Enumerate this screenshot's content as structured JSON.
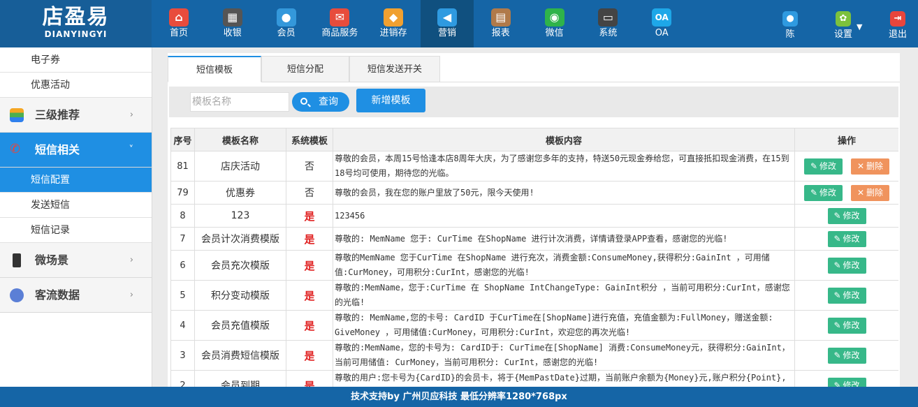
{
  "logo": {
    "cn": "店盈易",
    "en": "DIANYINGYI"
  },
  "nav": [
    {
      "label": "首页",
      "icon": "home-icon",
      "color": "#e84c3d",
      "glyph": "⌂"
    },
    {
      "label": "收银",
      "icon": "cash-register-icon",
      "color": "#555555",
      "glyph": "▦"
    },
    {
      "label": "会员",
      "icon": "member-icon",
      "color": "#3498db",
      "glyph": "●"
    },
    {
      "label": "商品服务",
      "icon": "goods-service-icon",
      "color": "#e74c3c",
      "glyph": "✉"
    },
    {
      "label": "进销存",
      "icon": "inventory-icon",
      "color": "#f0a030",
      "glyph": "◆"
    },
    {
      "label": "营销",
      "icon": "megaphone-icon",
      "color": "#2f9ae0",
      "glyph": "◀"
    },
    {
      "label": "报表",
      "icon": "report-icon",
      "color": "#b07a4a",
      "glyph": "▤"
    },
    {
      "label": "微信",
      "icon": "wechat-icon",
      "color": "#2fb34a",
      "glyph": "◉"
    },
    {
      "label": "系统",
      "icon": "monitor-icon",
      "color": "#444444",
      "glyph": "▭"
    },
    {
      "label": "OA",
      "icon": "oa-icon",
      "color": "#1ea7e8",
      "glyph": "OA"
    }
  ],
  "nav_right": [
    {
      "label": "陈",
      "icon": "user-icon",
      "color": "#2f9ae0",
      "glyph": "●"
    },
    {
      "label": "设置",
      "icon": "settings-icon",
      "color": "#7cc13d",
      "glyph": "✿",
      "caret": "▼"
    },
    {
      "label": "退出",
      "icon": "logout-icon",
      "color": "#e8453c",
      "glyph": "⇥"
    }
  ],
  "sidebar": {
    "top_items": [
      {
        "label": "电子券"
      },
      {
        "label": "优惠活动"
      }
    ],
    "cat_tiered": {
      "label": "三级推荐",
      "icon_color": "#4caf50",
      "arrow": "›"
    },
    "cat_sms": {
      "label": "短信相关",
      "icon_color": "#e8453c",
      "arrow": "˅"
    },
    "sms_items": [
      {
        "label": "短信配置"
      },
      {
        "label": "发送短信"
      },
      {
        "label": "短信记录"
      }
    ],
    "cat_micro": {
      "label": "微场景",
      "icon_color": "#333333",
      "arrow": "›"
    },
    "cat_traffic": {
      "label": "客流数据",
      "icon_color": "#5b7fd6",
      "arrow": "›"
    }
  },
  "tabs": [
    "短信模板",
    "短信分配",
    "短信发送开关"
  ],
  "search": {
    "placeholder": "模板名称",
    "query_label": "查询",
    "add_label": "新增模板"
  },
  "table": {
    "headers": [
      "序号",
      "模板名称",
      "系统模板",
      "模板内容",
      "操作"
    ],
    "edit_label": "修改",
    "delete_label": "删除",
    "rows": [
      {
        "id": "81",
        "name": "店庆活动",
        "system": "否",
        "content": "尊敬的会员，本周15号恰逢本店8周年大庆，为了感谢您多年的支持，特送50元现金券给您，可直接抵扣现金消费，在15到18号均可使用，期待您的光临。",
        "deletable": true
      },
      {
        "id": "79",
        "name": "优惠券",
        "system": "否",
        "content": "尊敬的会员，我在您的账户里放了50元，限今天使用!",
        "deletable": true
      },
      {
        "id": "8",
        "name": "123",
        "system": "是",
        "content": "123456",
        "deletable": false
      },
      {
        "id": "7",
        "name": "会员计次消费模版",
        "system": "是",
        "content": "尊敬的: MemName 您于: CurTime 在ShopName 进行计次消费，详情请登录APP查看，感谢您的光临!",
        "deletable": false
      },
      {
        "id": "6",
        "name": "会员充次模版",
        "system": "是",
        "content": "尊敬的MemName 您于CurTime 在ShopName 进行充次，消费金额:ConsumeMoney,获得积分:GainInt ，可用储值:CurMoney，可用积分:CurInt，感谢您的光临!",
        "deletable": false
      },
      {
        "id": "5",
        "name": "积分变动模版",
        "system": "是",
        "content": "尊敬的:MemName，您于:CurTime 在 ShopName IntChangeType: GainInt积分 ，当前可用积分:CurInt，感谢您的光临!",
        "deletable": false
      },
      {
        "id": "4",
        "name": "会员充值模版",
        "system": "是",
        "content": "尊敬的: MemName,您的卡号: CardID 于CurTime在[ShopName]进行充值，充值金额为:FullMoney，赠送金额: GiveMoney ，可用储值:CurMoney，可用积分:CurInt，欢迎您的再次光临!",
        "deletable": false
      },
      {
        "id": "3",
        "name": "会员消费短信模版",
        "system": "是",
        "content": "尊敬的:MemName，您的卡号为: CardID于: CurTime在[ShopName] 消费:ConsumeMoney元，获得积分:GainInt，当前可用储值: CurMoney，当前可用积分: CurInt，感谢您的光临!",
        "deletable": false
      },
      {
        "id": "2",
        "name": "会员到期",
        "system": "是",
        "content": "尊敬的用户:您卡号为{CardID}的会员卡，将于{MemPastDate}过期，当前账户余额为{Money}元,账户积分{Point},请及时充值或续期!",
        "deletable": false
      }
    ]
  },
  "footer": {
    "text": "技术支持by 广州贝应科技    最低分辨率1280*768px"
  },
  "colors": {
    "primary": "#1565a6",
    "accent": "#1f8fe3",
    "edit": "#37b889",
    "delete": "#f0935d",
    "system_yes": "#e02020"
  }
}
